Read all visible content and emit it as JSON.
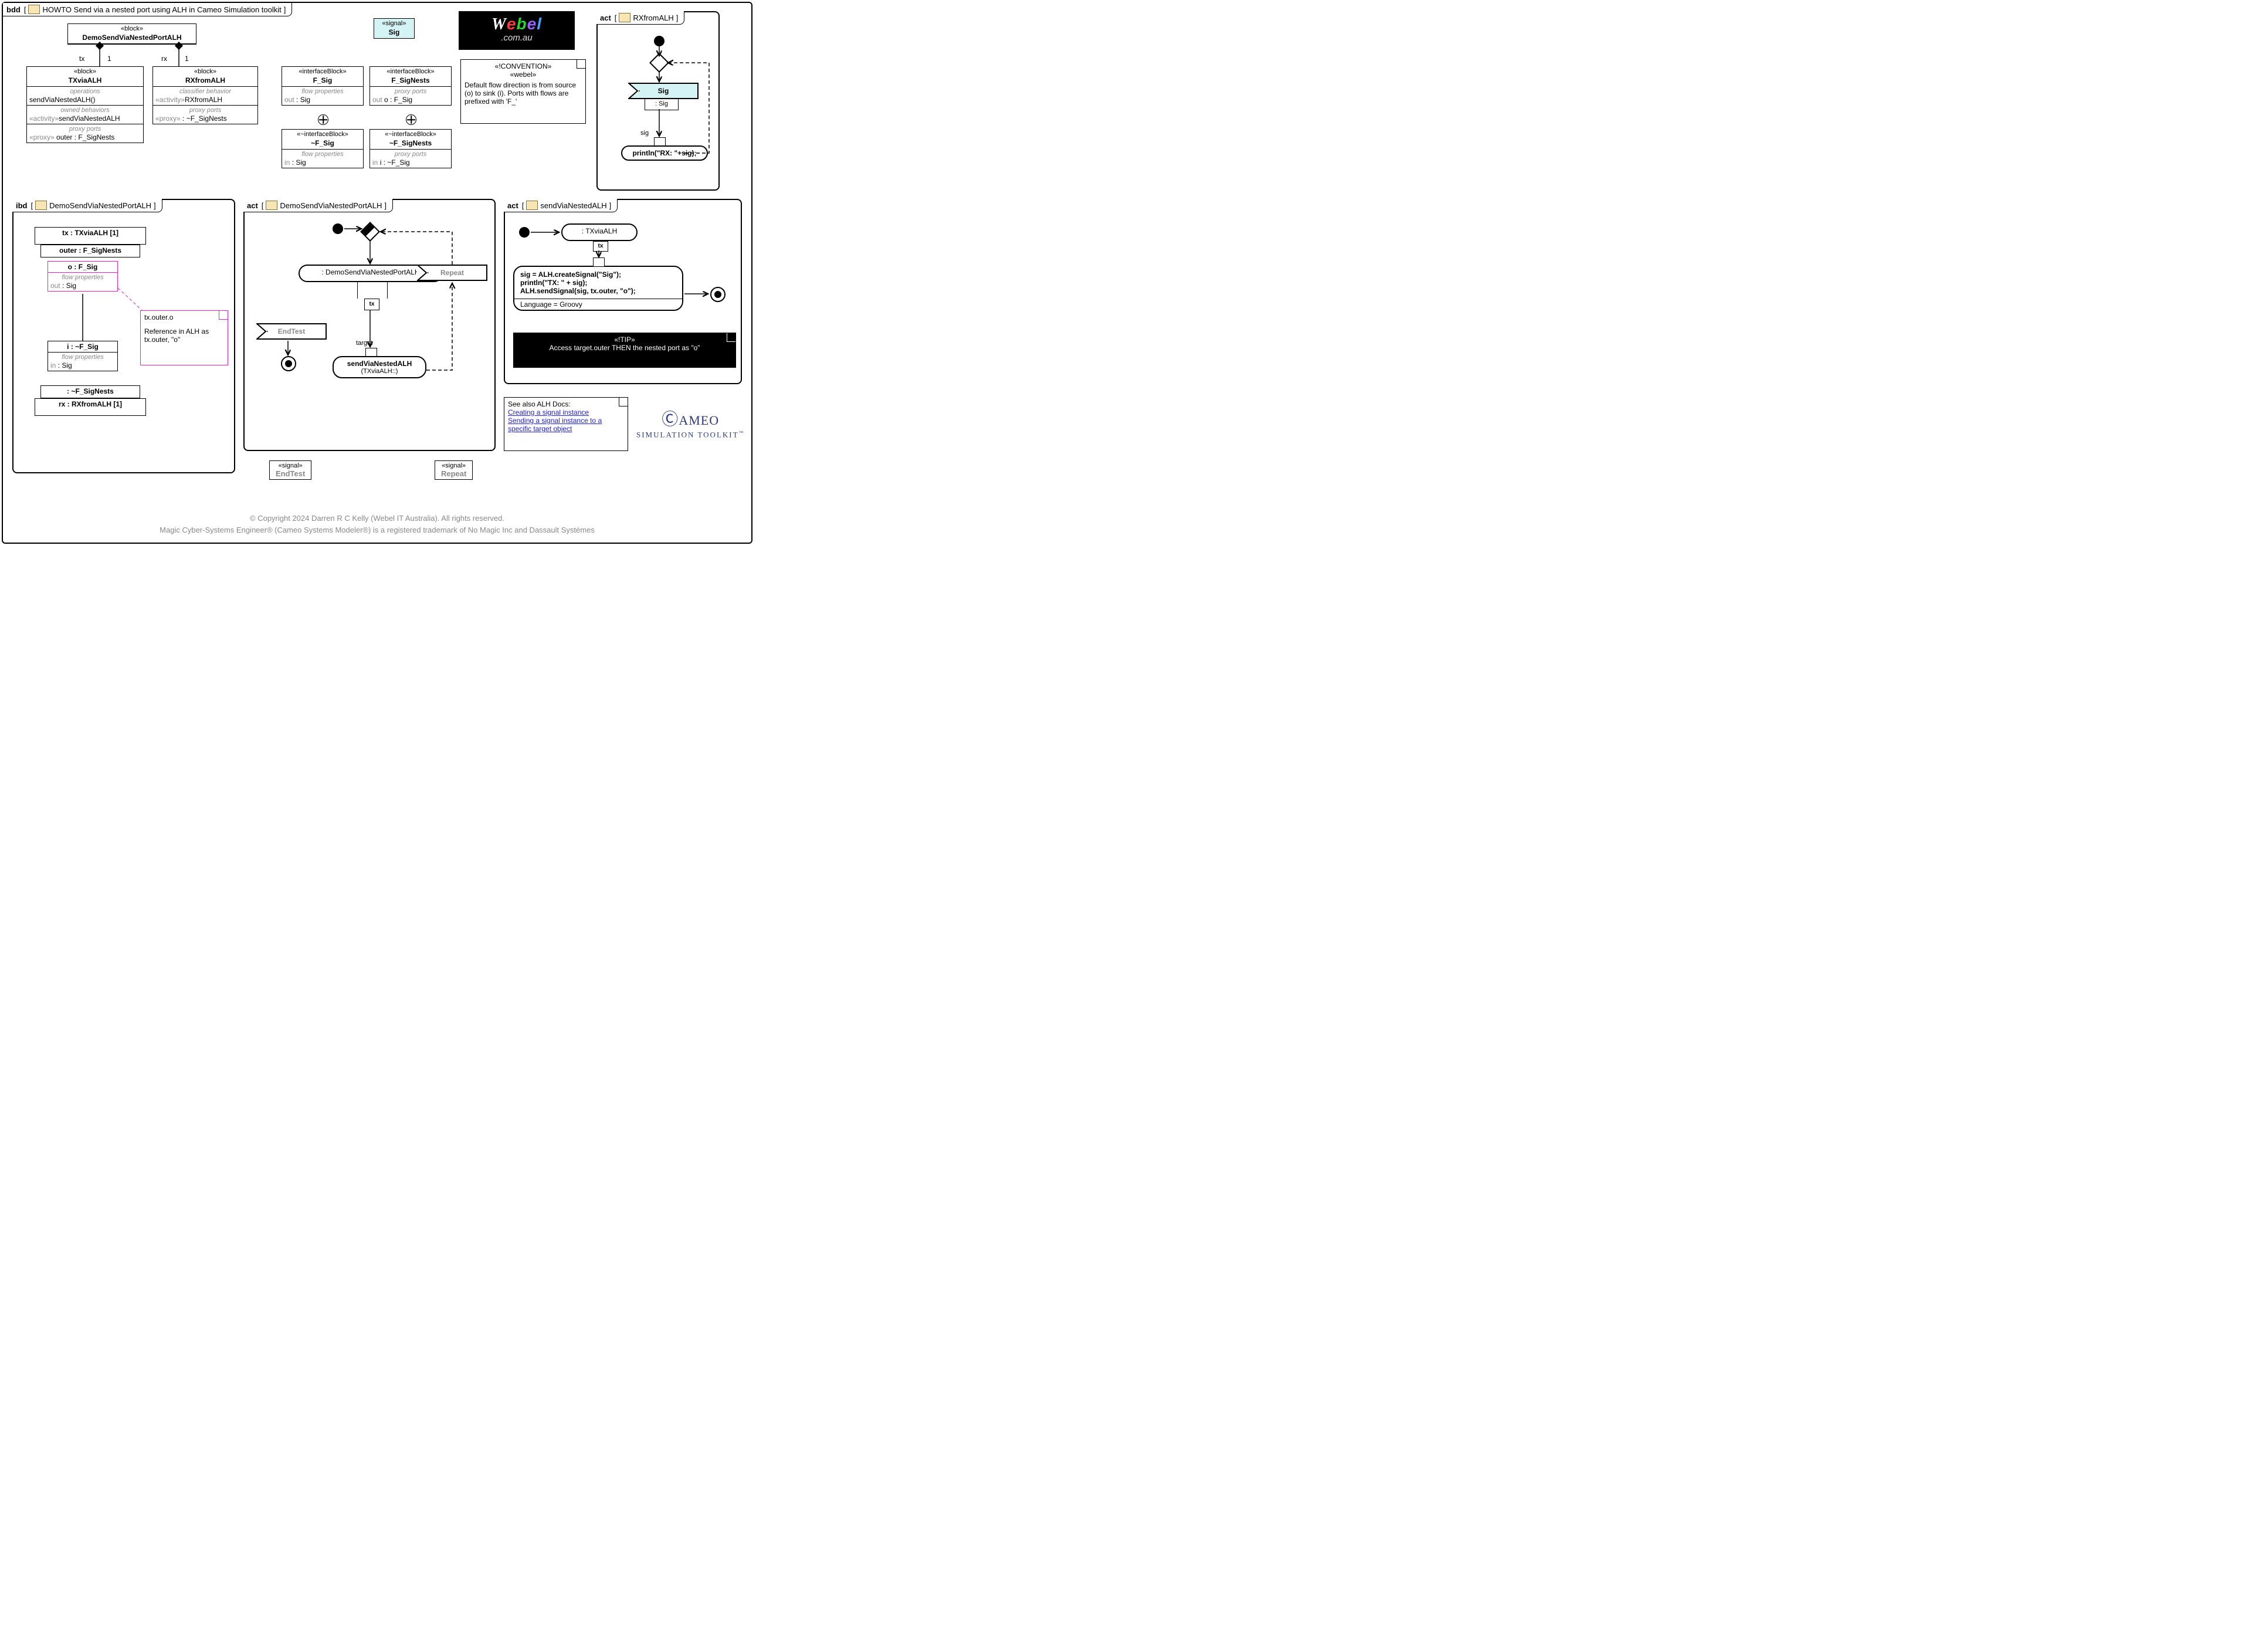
{
  "bdd": {
    "kind": "bdd",
    "title": "HOWTO Send via a nested port using ALH in Cameo Simulation toolkit",
    "topBlock": {
      "stereo": "«block»",
      "name": "DemoSendViaNestedPortALH"
    },
    "tx": {
      "stereo": "«block»",
      "name": "TXviaALH",
      "operationsLabel": "operations",
      "operations": "sendViaNestedALH()",
      "ownedBehaviorsLabel": "owned behaviors",
      "ownedBehaviors": "«activity»sendViaNestedALH",
      "proxyPortsLabel": "proxy ports",
      "proxyPorts": "«proxy» outer : F_SigNests"
    },
    "rx": {
      "stereo": "«block»",
      "name": "RXfromALH",
      "classifierBehaviorLabel": "classifier behavior",
      "classifierBehavior": "«activity»RXfromALH",
      "proxyPortsLabel": "proxy ports",
      "proxyPorts": "«proxy»  : ~F_SigNests"
    },
    "assoc": {
      "txEnd": "tx",
      "txMult": "1",
      "rxEnd": "rx",
      "rxMult": "1"
    },
    "fsig": {
      "stereo": "«interfaceBlock»",
      "name": "F_Sig",
      "flowLabel": "flow properties",
      "flow": "out  : Sig"
    },
    "fsigc": {
      "stereo": "«~interfaceBlock»",
      "name": "~F_Sig",
      "flowLabel": "flow properties",
      "flow": "in  : Sig"
    },
    "fsignests": {
      "stereo": "«interfaceBlock»",
      "name": "F_SigNests",
      "ppLabel": "proxy ports",
      "pp": "out o : F_Sig"
    },
    "fsignestsc": {
      "stereo": "«~interfaceBlock»",
      "name": "~F_SigNests",
      "ppLabel": "proxy ports",
      "pp": "in i : ~F_Sig"
    },
    "signal": {
      "stereo": "«signal»",
      "name": "Sig"
    },
    "convention": {
      "stereoA": "«!CONVENTION»",
      "stereoB": "«webel»",
      "text": "Default flow direction is from source (o) to sink (i). Ports with flows are prefixed with 'F_'"
    }
  },
  "logo": {
    "l1a": "W",
    "l1b": "e",
    "l1c": "b",
    "l1d": "e",
    "l1e": "l",
    "l2": ".com.au"
  },
  "actRX": {
    "kind": "act",
    "title": "RXfromALH",
    "accept": "Sig",
    "acceptType": ": Sig",
    "pin": "sig",
    "action": "println(\"RX: \"+sig);"
  },
  "ibd": {
    "kind": "ibd",
    "title": "DemoSendViaNestedPortALH",
    "tx": "tx : TXviaALH [1]",
    "outer": "outer : F_SigNests",
    "o": {
      "name": "o : F_Sig",
      "flLabel": "flow properties",
      "fl": "out  : Sig"
    },
    "i": {
      "name": "i : ~F_Sig",
      "flLabel": "flow properties",
      "fl": "in  : Sig"
    },
    "inner": " : ~F_SigNests",
    "rx": "rx : RXfromALH [1]",
    "note": {
      "line1": "tx.outer.o",
      "line2": "Reference in ALH as tx.outer, \"o\""
    }
  },
  "actDemo": {
    "kind": "act",
    "title": "DemoSendViaNestedPortALH",
    "topAction": ": DemoSendViaNestedPortALH",
    "pin": "tx",
    "targetLabel": "target",
    "call": "sendViaNestedALH",
    "callSub": "(TXviaALH::)",
    "endTest": "EndTest",
    "repeat": "Repeat",
    "sigEndTest": {
      "stereo": "«signal»",
      "name": "EndTest"
    },
    "sigRepeat": {
      "stereo": "«signal»",
      "name": "Repeat"
    }
  },
  "actSend": {
    "kind": "act",
    "title": "sendViaNestedALH",
    "self": ": TXviaALH",
    "pin": "tx",
    "code1": "sig = ALH.createSignal(\"Sig\");",
    "code2": "println(\"TX: \" + sig);",
    "code3": "ALH.sendSignal(sig, tx.outer, \"o\");",
    "lang": "Language = Groovy",
    "tip": {
      "stereo": "«!TIP»",
      "text": "Access target.outer THEN the nested port as \"o\""
    }
  },
  "seeAlso": {
    "title": "See also ALH Docs:",
    "link1": "Creating a signal instance",
    "link2": "Sending a signal instance to a specific target object"
  },
  "cameo": {
    "main": "CAMEO",
    "sub": "SIMULATION TOOLKIT",
    "tm": "™"
  },
  "footer": {
    "line1": "© Copyright 2024 Darren R C Kelly (Webel IT Australia). All rights reserved.",
    "line2": "Magic Cyber-Systems Engineer® (Cameo Systems Modeler®) is  a registered trademark of No Magic Inc and Dassault Systèmes"
  }
}
